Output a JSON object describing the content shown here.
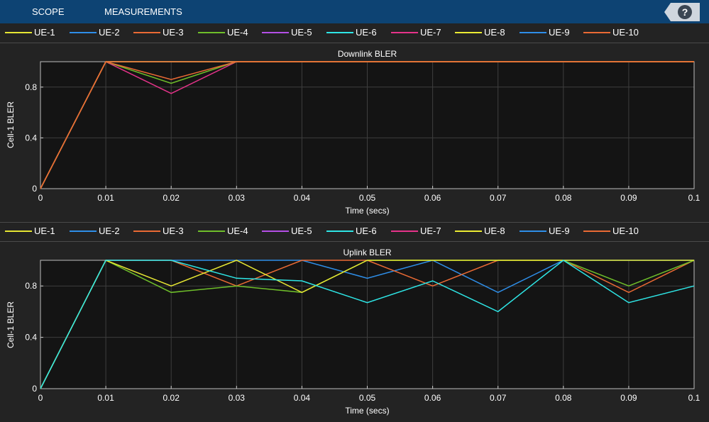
{
  "toolbar": {
    "tabs": [
      {
        "label": "SCOPE"
      },
      {
        "label": "MEASUREMENTS"
      }
    ],
    "help_label": "?"
  },
  "legend": [
    {
      "name": "UE-1",
      "color": "#e6e633"
    },
    {
      "name": "UE-2",
      "color": "#2e8ee8"
    },
    {
      "name": "UE-3",
      "color": "#ea6a34"
    },
    {
      "name": "UE-4",
      "color": "#6fbf2a"
    },
    {
      "name": "UE-5",
      "color": "#b44fe6"
    },
    {
      "name": "UE-6",
      "color": "#2ee6e6"
    },
    {
      "name": "UE-7",
      "color": "#e6338a"
    },
    {
      "name": "UE-8",
      "color": "#ebeb33"
    },
    {
      "name": "UE-9",
      "color": "#2e8ee8"
    },
    {
      "name": "UE-10",
      "color": "#ea6a34"
    }
  ],
  "chart_data": [
    {
      "type": "line",
      "title": "Downlink BLER",
      "xlabel": "Time (secs)",
      "ylabel": "Cell-1 BLER",
      "xlim": [
        0,
        0.1
      ],
      "ylim": [
        0,
        1
      ],
      "xticks": [
        "0",
        "0.01",
        "0.02",
        "0.03",
        "0.04",
        "0.05",
        "0.06",
        "0.07",
        "0.08",
        "0.09",
        "0.1"
      ],
      "yticks": [
        "0",
        "0.4",
        "0.8"
      ],
      "grid": true,
      "series": [
        {
          "name": "UE-1",
          "color": "#e6e633",
          "x": [
            0,
            0.01,
            0.02,
            0.03,
            0.1
          ],
          "y": [
            0,
            1,
            1,
            1,
            1
          ]
        },
        {
          "name": "UE-2",
          "color": "#2e8ee8",
          "x": [
            0,
            0.01,
            0.02,
            0.03,
            0.1
          ],
          "y": [
            0,
            1,
            1,
            1,
            1
          ]
        },
        {
          "name": "UE-7",
          "color": "#e6338a",
          "x": [
            0,
            0.01,
            0.02,
            0.03,
            0.1
          ],
          "y": [
            0,
            1,
            0.75,
            1,
            1
          ]
        },
        {
          "name": "UE-4",
          "color": "#6fbf2a",
          "x": [
            0,
            0.01,
            0.02,
            0.03,
            0.1
          ],
          "y": [
            0,
            1,
            0.83,
            1,
            1
          ]
        },
        {
          "name": "UE-8",
          "color": "#ebeb33",
          "x": [
            0,
            0.01,
            0.02,
            0.03,
            0.1
          ],
          "y": [
            0,
            1,
            1,
            1,
            1
          ]
        },
        {
          "name": "UE-3",
          "color": "#ea6a34",
          "x": [
            0,
            0.01,
            0.02,
            0.03,
            0.1
          ],
          "y": [
            0,
            1,
            0.86,
            1,
            1
          ]
        },
        {
          "name": "UE-10",
          "color": "#ea6a34",
          "x": [
            0,
            0.01,
            0.02,
            0.03,
            0.1
          ],
          "y": [
            0,
            1,
            1,
            1,
            1
          ]
        }
      ]
    },
    {
      "type": "line",
      "title": "Uplink BLER",
      "xlabel": "Time (secs)",
      "ylabel": "Cell-1 BLER",
      "xlim": [
        0,
        0.1
      ],
      "ylim": [
        0,
        1
      ],
      "xticks": [
        "0",
        "0.01",
        "0.02",
        "0.03",
        "0.04",
        "0.05",
        "0.06",
        "0.07",
        "0.08",
        "0.09",
        "0.1"
      ],
      "yticks": [
        "0",
        "0.4",
        "0.8"
      ],
      "grid": true,
      "series": [
        {
          "name": "UE-2",
          "color": "#2e8ee8",
          "x": [
            0,
            0.01,
            0.02,
            0.03,
            0.04,
            0.05,
            0.06,
            0.07,
            0.08,
            0.09,
            0.1
          ],
          "y": [
            0,
            1,
            1,
            1,
            1,
            0.86,
            1,
            0.75,
            1,
            1,
            1
          ]
        },
        {
          "name": "UE-3",
          "color": "#ea6a34",
          "x": [
            0,
            0.01,
            0.02,
            0.03,
            0.04,
            0.05,
            0.06,
            0.07,
            0.08,
            0.09,
            0.1
          ],
          "y": [
            0,
            1,
            1,
            0.8,
            1,
            1,
            0.8,
            1,
            1,
            0.75,
            1
          ]
        },
        {
          "name": "UE-4",
          "color": "#6fbf2a",
          "x": [
            0,
            0.01,
            0.02,
            0.03,
            0.04,
            0.05,
            0.06,
            0.07,
            0.08,
            0.09,
            0.1
          ],
          "y": [
            0,
            1,
            0.75,
            0.8,
            0.75,
            1,
            1,
            1,
            1,
            0.8,
            1
          ]
        },
        {
          "name": "UE-1",
          "color": "#e6e633",
          "x": [
            0,
            0.01,
            0.02,
            0.03,
            0.04,
            0.05,
            0.06,
            0.07,
            0.08,
            0.09,
            0.1
          ],
          "y": [
            0,
            1,
            0.8,
            1,
            0.75,
            1,
            1,
            1,
            1,
            1,
            1
          ]
        },
        {
          "name": "UE-6",
          "color": "#2ee6e6",
          "x": [
            0,
            0.01,
            0.02,
            0.03,
            0.04,
            0.05,
            0.06,
            0.07,
            0.08,
            0.09,
            0.1
          ],
          "y": [
            0,
            1,
            1,
            0.86,
            0.84,
            0.67,
            0.84,
            0.6,
            1,
            0.67,
            0.8
          ]
        }
      ]
    }
  ]
}
